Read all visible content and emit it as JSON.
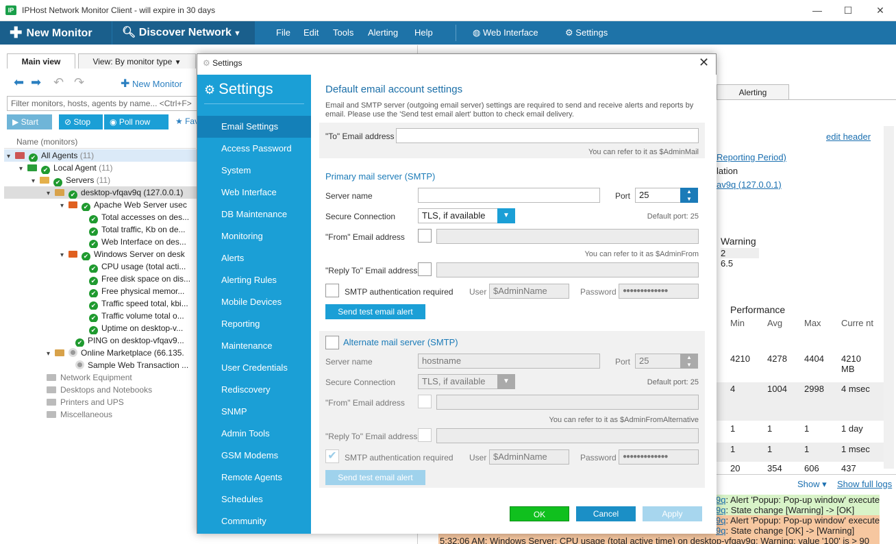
{
  "window": {
    "title": "IPHost Network Monitor Client - will expire in 30 days",
    "icon_text": "IP",
    "minimize": "—",
    "maximize": "☐",
    "close": "✕"
  },
  "toolbar": {
    "new_monitor": "New Monitor",
    "discover": "Discover Network",
    "menus": [
      "File",
      "Edit",
      "Tools",
      "Alerting",
      "Help"
    ],
    "web_interface": "Web Interface",
    "settings": "Settings"
  },
  "left": {
    "tabs": [
      "Main view",
      "View: By monitor type"
    ],
    "new_monitor": "New Monitor",
    "filter_placeholder": "Filter monitors, hosts, agents by name... <Ctrl+F>",
    "buttons": [
      "Start",
      "Stop",
      "Poll now",
      "Fav"
    ],
    "column": "Name (monitors)",
    "tree": [
      {
        "label": "All Agents",
        "count": "(11)"
      },
      {
        "label": "Local Agent",
        "count": "(11)"
      },
      {
        "label": "Servers",
        "count": "(11)"
      },
      {
        "label": "desktop-vfqav9q (127.0.0.1)"
      },
      {
        "label": "Apache Web Server usec"
      },
      {
        "label": "Total accesses on des..."
      },
      {
        "label": "Total traffic, Kb on de..."
      },
      {
        "label": "Web Interface on des..."
      },
      {
        "label": "Windows Server on desk"
      },
      {
        "label": "CPU usage (total acti..."
      },
      {
        "label": "Free disk space on dis..."
      },
      {
        "label": "Free physical memor..."
      },
      {
        "label": "Traffic speed total, kbi..."
      },
      {
        "label": "Traffic volume total o..."
      },
      {
        "label": "Uptime on desktop-v..."
      },
      {
        "label": "PING on desktop-vfqav9..."
      },
      {
        "label": "Online Marketplace (66.135."
      },
      {
        "label": "Sample Web Transaction ..."
      },
      {
        "label": "Network Equipment"
      },
      {
        "label": "Desktops and Notebooks"
      },
      {
        "label": "Printers and UPS"
      },
      {
        "label": "Miscellaneous"
      }
    ]
  },
  "right": {
    "tab_alerting": "Alerting",
    "edit_header": "edit header",
    "reporting_period": "Reporting Period)",
    "lation": "lation",
    "host_link": "av9q (127.0.0.1)",
    "warning": "Warning",
    "w1": "2",
    "w2": "6.5",
    "performance": "Performance",
    "perf_cols": [
      "Min",
      "Avg",
      "Max",
      "Curre nt"
    ],
    "perf_rows": [
      [
        "4210",
        "4278",
        "4404",
        "4210 MB"
      ],
      [
        "4",
        "1004",
        "2998",
        "4 msec"
      ],
      [
        "1",
        "1",
        "1",
        "1 day"
      ],
      [
        "1",
        "1",
        "1",
        "1 msec"
      ],
      [
        "20",
        "354",
        "606",
        "437"
      ]
    ],
    "show": "Show",
    "show_full": "Show full logs",
    "logs": [
      {
        "p": "9q",
        "t": ": Alert 'Popup: Pop-up window' executed",
        "c": "#d8f3c8"
      },
      {
        "p": "9q",
        "t": ": State change [Warning] -> [OK]",
        "c": "#d8f3c8"
      },
      {
        "p": "9q",
        "t": ": Alert 'Popup: Pop-up window' executed",
        "c": "#f6c7a0"
      },
      {
        "p": "9q",
        "t": ": State change [OK] -> [Warning]",
        "c": "#f6c7a0"
      },
      {
        "p": "5:32:06 AM: Windows Server: CPU usage (total active time) on desktop-vfqav9q: Warning: value '100' is > 90",
        "t": "",
        "c": "#f6c7a0"
      }
    ]
  },
  "dialog": {
    "title": "Settings",
    "close": "✕",
    "side_title": "Settings",
    "side_items": [
      "Email Settings",
      "Access Password",
      "System",
      "Web Interface",
      "DB Maintenance",
      "Monitoring",
      "Alerts",
      "Alerting Rules",
      "Mobile Devices",
      "Reporting",
      "Maintenance",
      "User Credentials",
      "Rediscovery",
      "SNMP",
      "Admin Tools",
      "GSM Modems",
      "Remote Agents",
      "Schedules",
      "Community"
    ],
    "heading": "Default email account settings",
    "desc": "Email and SMTP server (outgoing email server) settings are required to send and receive alerts and reports by email. Please use the 'Send test email alert' button to check email delivery.",
    "to_label": "\"To\" Email address",
    "to_value": "",
    "to_hint": "You can refer to it as $AdminMail",
    "primary": {
      "heading": "Primary mail server (SMTP)",
      "server_label": "Server name",
      "server_value": "",
      "port_label": "Port",
      "port_value": "25",
      "secure_label": "Secure Connection",
      "secure_value": "TLS, if available",
      "default_port": "Default port: 25",
      "from_label": "\"From\" Email address",
      "from_hint": "You can refer to it as $AdminFrom",
      "reply_label": "\"Reply To\" Email address",
      "auth_label": "SMTP authentication required",
      "user_label": "User",
      "user_value": "$AdminName",
      "pass_label": "Password",
      "pass_value": "●●●●●●●●●●●●●",
      "test_btn": "Send test email alert"
    },
    "alternate": {
      "heading": "Alternate mail server (SMTP)",
      "server_label": "Server name",
      "server_value": "hostname",
      "port_label": "Port",
      "port_value": "25",
      "secure_label": "Secure Connection",
      "secure_value": "TLS, if available",
      "default_port": "Default port: 25",
      "from_label": "\"From\" Email address",
      "from_hint": "You can refer to it as $AdminFromAlternative",
      "reply_label": "\"Reply To\" Email address",
      "auth_label": "SMTP authentication required",
      "user_label": "User",
      "user_value": "$AdminName",
      "pass_label": "Password",
      "pass_value": "●●●●●●●●●●●●●",
      "test_btn": "Send test email alert"
    },
    "ok": "OK",
    "cancel": "Cancel",
    "apply": "Apply"
  },
  "colors": {
    "accent": "#1b9fd6",
    "toolbar": "#1e73a8",
    "ok_green": "#1f9a2f"
  }
}
